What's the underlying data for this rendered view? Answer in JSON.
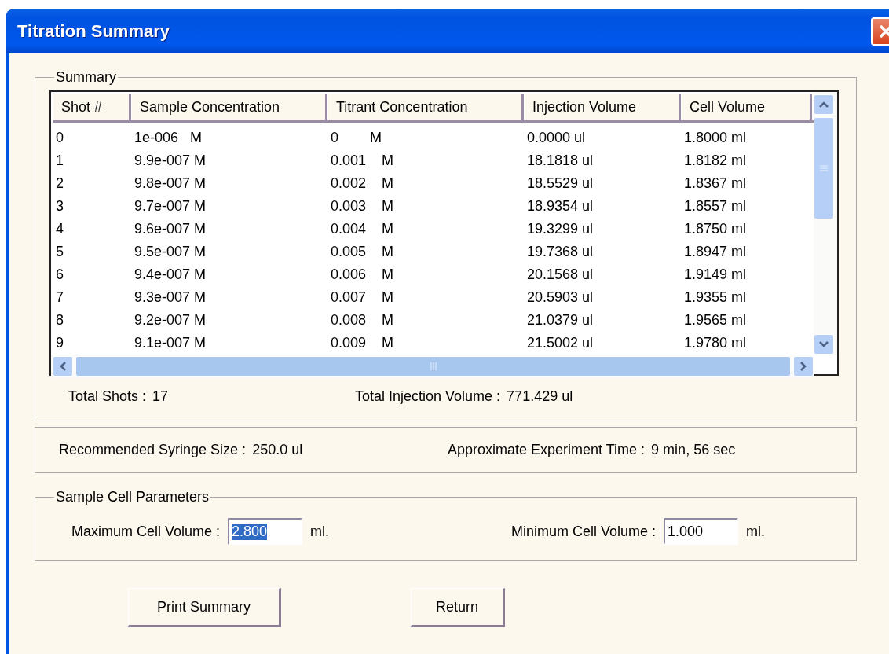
{
  "window": {
    "title": "Titration Summary"
  },
  "summary": {
    "legend": "Summary",
    "table": {
      "columns": [
        "Shot #",
        "Sample Concentration",
        "Titrant Concentration",
        "Injection Volume",
        "Cell Volume"
      ],
      "rows": [
        [
          "0",
          "1e-006   M",
          "0        M",
          "0.0000 ul",
          "1.8000 ml"
        ],
        [
          "1",
          "9.9e-007 M",
          "0.001    M",
          "18.1818 ul",
          "1.8182 ml"
        ],
        [
          "2",
          "9.8e-007 M",
          "0.002    M",
          "18.5529 ul",
          "1.8367 ml"
        ],
        [
          "3",
          "9.7e-007 M",
          "0.003    M",
          "18.9354 ul",
          "1.8557 ml"
        ],
        [
          "4",
          "9.6e-007 M",
          "0.004    M",
          "19.3299 ul",
          "1.8750 ml"
        ],
        [
          "5",
          "9.5e-007 M",
          "0.005    M",
          "19.7368 ul",
          "1.8947 ml"
        ],
        [
          "6",
          "9.4e-007 M",
          "0.006    M",
          "20.1568 ul",
          "1.9149 ml"
        ],
        [
          "7",
          "9.3e-007 M",
          "0.007    M",
          "20.5903 ul",
          "1.9355 ml"
        ],
        [
          "8",
          "9.2e-007 M",
          "0.008    M",
          "21.0379 ul",
          "1.9565 ml"
        ],
        [
          "9",
          "9.1e-007 M",
          "0.009    M",
          "21.5002 ul",
          "1.9780 ml"
        ]
      ]
    },
    "totals": [
      {
        "label": "Total Shots :",
        "value": "17"
      },
      {
        "label": "Total Injection Volume :",
        "value": "771.429 ul"
      }
    ]
  },
  "estimates": [
    {
      "label": "Recommended Syringe Size :",
      "value": "250.0 ul"
    },
    {
      "label": "Approximate Experiment Time :",
      "value": "9 min, 56 sec"
    }
  ],
  "parameters": {
    "legend": "Sample Cell Parameters",
    "fields": [
      {
        "label": "Maximum Cell Volume :",
        "value": "2.800",
        "unit": "ml.",
        "text_selected": true
      },
      {
        "label": "Minimum Cell Volume :",
        "value": "1.000",
        "unit": "ml.",
        "text_selected": false
      }
    ]
  },
  "buttons": [
    "Print Summary",
    "Return"
  ]
}
